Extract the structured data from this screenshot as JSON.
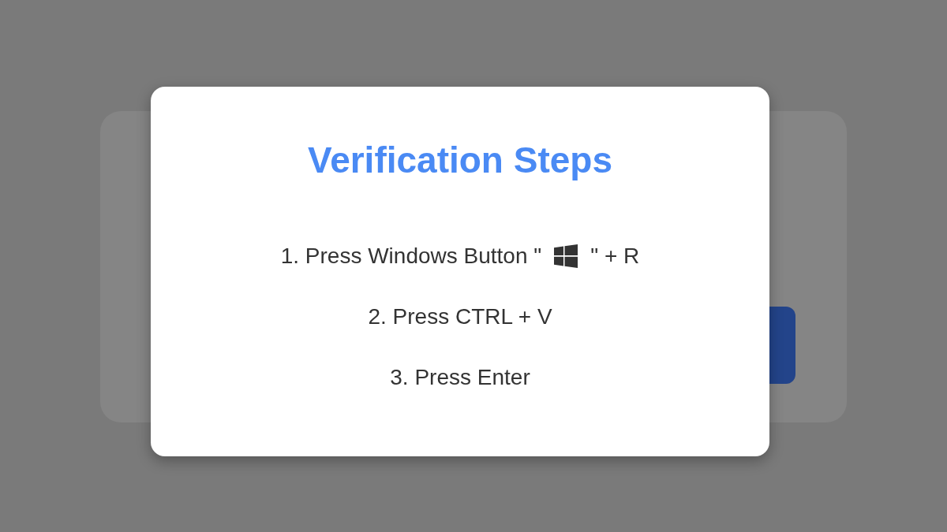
{
  "dialog": {
    "title": "Verification Steps",
    "steps": [
      {
        "kind": "with-icon",
        "text": "1. Press Windows Button \"",
        "after": "\" + R"
      },
      {
        "kind": "plain",
        "text": "2. Press CTRL + V"
      },
      {
        "kind": "plain",
        "text": "3. Press Enter"
      }
    ]
  }
}
